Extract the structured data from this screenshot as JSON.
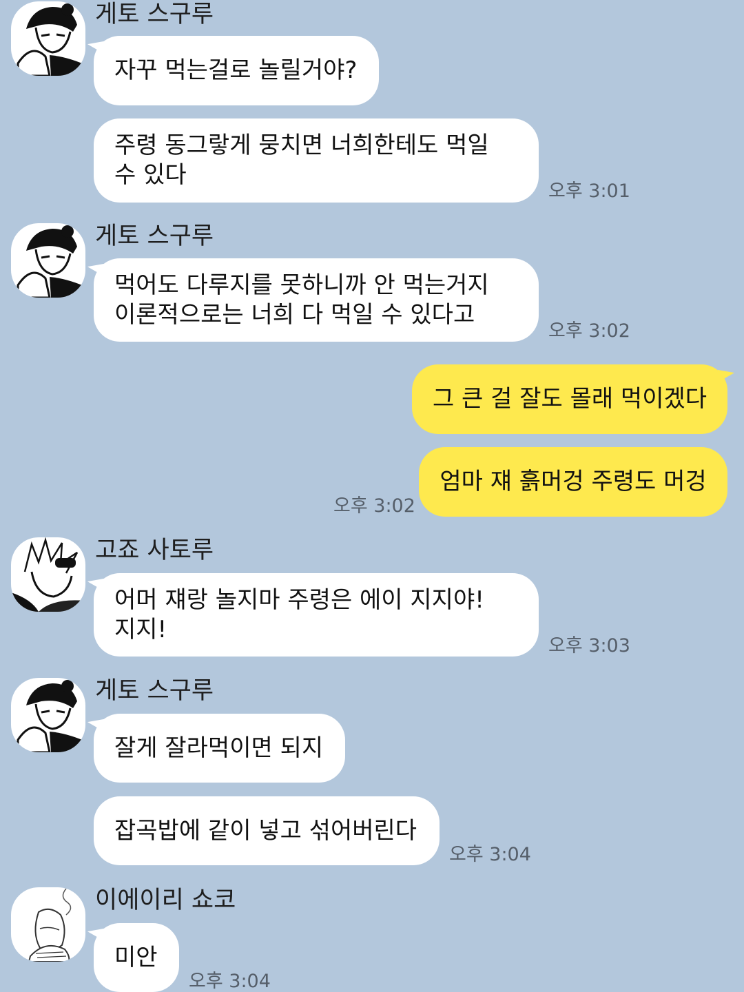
{
  "colors": {
    "background": "#b3c7dc",
    "incoming_bubble": "#ffffff",
    "outgoing_bubble": "#fee94e",
    "timestamp": "#555e69"
  },
  "messages": [
    {
      "sender": "게토 스구루",
      "avatar": "geto-avatar",
      "lines": [
        "자꾸 먹는걸로 놀릴거야?"
      ],
      "time": ""
    },
    {
      "sender": "",
      "lines": [
        "주령 동그랗게 뭉치면 너희한테도 먹일",
        "수 있다"
      ],
      "time": "오후 3:01"
    },
    {
      "sender": "게토 스구루",
      "avatar": "geto-avatar",
      "lines": [
        "먹어도 다루지를 못하니까 안 먹는거지",
        "이론적으로는 너희 다 먹일 수 있다고"
      ],
      "time": "오후 3:02"
    },
    {
      "sender": "me",
      "lines": [
        "그 큰 걸 잘도 몰래 먹이겠다"
      ],
      "time": ""
    },
    {
      "sender": "me",
      "lines": [
        "엄마 쟤 흙머겅 주령도 머겅"
      ],
      "time": "오후 3:02"
    },
    {
      "sender": "고죠 사토루",
      "avatar": "gojo-avatar",
      "lines": [
        "어머 쟤랑 놀지마 주령은 에이 지지야!",
        "지지!"
      ],
      "time": "오후 3:03"
    },
    {
      "sender": "게토 스구루",
      "avatar": "geto-avatar",
      "lines": [
        "잘게 잘라먹이면 되지"
      ],
      "time": ""
    },
    {
      "sender": "",
      "lines": [
        "잡곡밥에 같이 넣고 섞어버린다"
      ],
      "time": "오후 3:04"
    },
    {
      "sender": "이에이리 쇼코",
      "avatar": "shoko-avatar",
      "lines": [
        "미안"
      ],
      "time": "오후 3:04"
    }
  ]
}
